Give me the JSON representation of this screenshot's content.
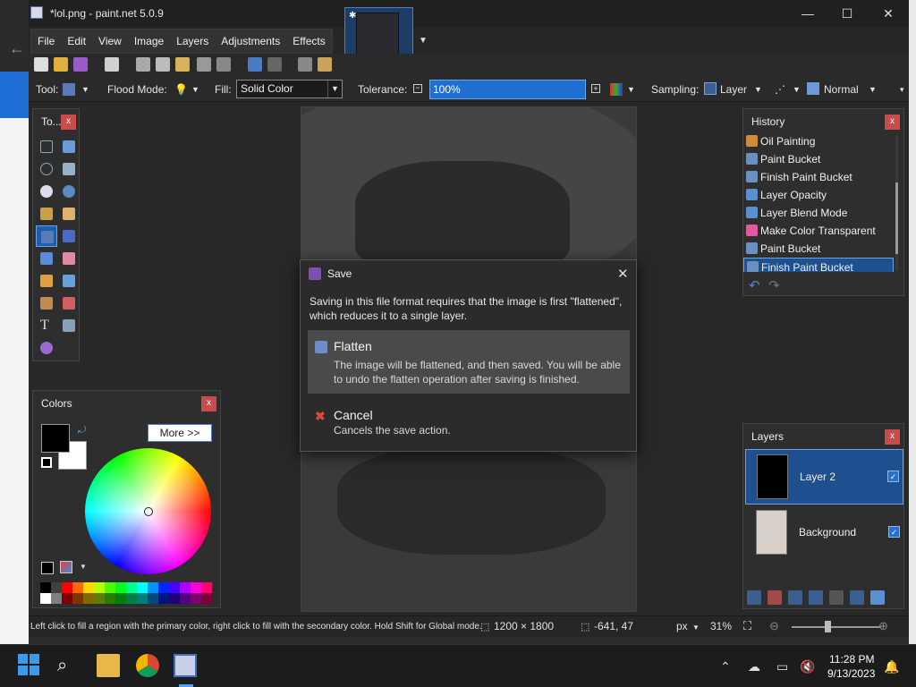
{
  "window": {
    "title": "*lol.png - paint.net 5.0.9",
    "minimize": "—",
    "maximize": "☐",
    "close": "✕"
  },
  "menu": [
    "File",
    "Edit",
    "View",
    "Image",
    "Layers",
    "Adjustments",
    "Effects"
  ],
  "tool_options": {
    "tool_label": "Tool:",
    "flood_mode_label": "Flood Mode:",
    "fill_label": "Fill:",
    "fill_value": "Solid Color",
    "tolerance_label": "Tolerance:",
    "tolerance_value": "100%",
    "sampling_label": "Sampling:",
    "sampling_value": "Layer",
    "blend_value": "Normal"
  },
  "tools_panel": {
    "title": "To..."
  },
  "colors_panel": {
    "title": "Colors",
    "more_label": "More >>",
    "primary_color": "#000000",
    "secondary_color": "#ffffff",
    "palette": [
      "#000000",
      "#404040",
      "#ff0000",
      "#ff6a00",
      "#ffd800",
      "#b6ff00",
      "#4cff00",
      "#00ff21",
      "#00ff90",
      "#00ffff",
      "#0094ff",
      "#0026ff",
      "#4800ff",
      "#b200ff",
      "#ff00dc",
      "#ff006e",
      "#ffffff",
      "#808080",
      "#7f0000",
      "#7f3300",
      "#7f6a00",
      "#5b7f00",
      "#267f00",
      "#007f0e",
      "#007f46",
      "#007f7f",
      "#004a7f",
      "#00137f",
      "#21007f",
      "#57007f",
      "#7f006e",
      "#7f0037"
    ]
  },
  "history_panel": {
    "title": "History",
    "items": [
      {
        "label": "Oil Painting",
        "icon": "oil-painting-icon",
        "color": "#d08a3a"
      },
      {
        "label": "Paint Bucket",
        "icon": "paint-bucket-icon",
        "color": "#6a8fc0"
      },
      {
        "label": "Finish Paint Bucket",
        "icon": "paint-bucket-icon",
        "color": "#6a8fc0"
      },
      {
        "label": "Layer Opacity",
        "icon": "wrench-icon",
        "color": "#5a8fd0"
      },
      {
        "label": "Layer Blend Mode",
        "icon": "wrench-icon",
        "color": "#5a8fd0"
      },
      {
        "label": "Make Color Transparent",
        "icon": "color-wheel-icon",
        "color": "#e05aa0"
      },
      {
        "label": "Paint Bucket",
        "icon": "paint-bucket-icon",
        "color": "#6a8fc0"
      },
      {
        "label": "Finish Paint Bucket",
        "icon": "paint-bucket-icon",
        "color": "#6a8fc0",
        "selected": true
      }
    ]
  },
  "layers_panel": {
    "title": "Layers",
    "layers": [
      {
        "name": "Layer 2",
        "visible": true,
        "selected": true
      },
      {
        "name": "Background",
        "visible": true,
        "selected": false
      }
    ]
  },
  "dialog": {
    "title": "Save",
    "message": "Saving in this file format requires that the image is first \"flattened\", which reduces it to a single layer.",
    "flatten_title": "Flatten",
    "flatten_desc": "The image will be flattened, and then saved. You will be able to undo the flatten operation after saving is finished.",
    "cancel_title": "Cancel",
    "cancel_desc": "Cancels the save action."
  },
  "status": {
    "hint": "Left click to fill a region with the primary color, right click to fill with the secondary color. Hold Shift for Global mode.",
    "image_size": "1200 × 1800",
    "cursor_pos": "-641, 47",
    "units": "px",
    "zoom": "31%"
  },
  "taskbar": {
    "time": "11:28 PM",
    "date": "9/13/2023"
  }
}
